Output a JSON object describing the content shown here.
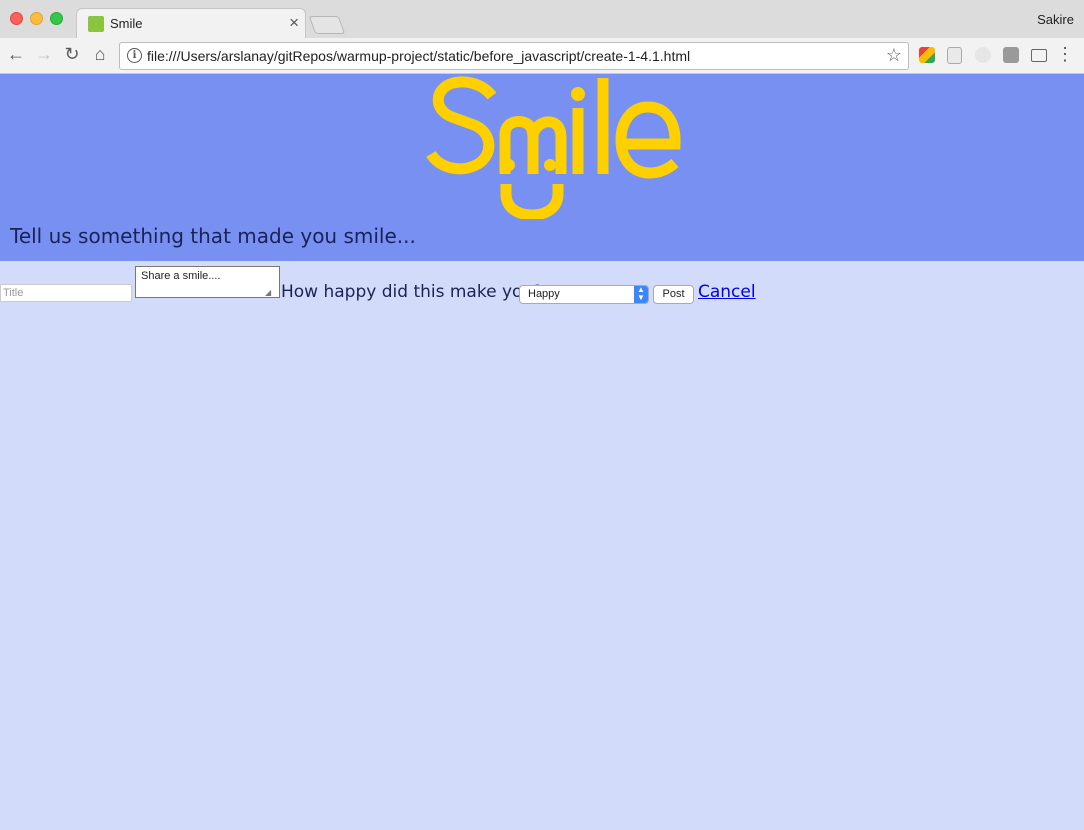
{
  "browser": {
    "tab_title": "Smile",
    "profile_name": "Sakire",
    "url": "file:///Users/arslanay/gitRepos/warmup-project/static/before_javascript/create-1-4.1.html",
    "close_glyph": "×"
  },
  "banner": {
    "logo_text": "Smile",
    "logo_color": "#ffd000",
    "background_color": "#7890f2",
    "tagline": "Tell us something that made you smile..."
  },
  "form": {
    "title_placeholder": "Title",
    "story_placeholder": "Share a smile....",
    "question": "How happy did this make you?",
    "happiness_selected": "Happy",
    "post_label": "Post",
    "cancel_label": "Cancel"
  },
  "colors": {
    "page_background": "#d3dbfa",
    "link": "#0000ee"
  }
}
